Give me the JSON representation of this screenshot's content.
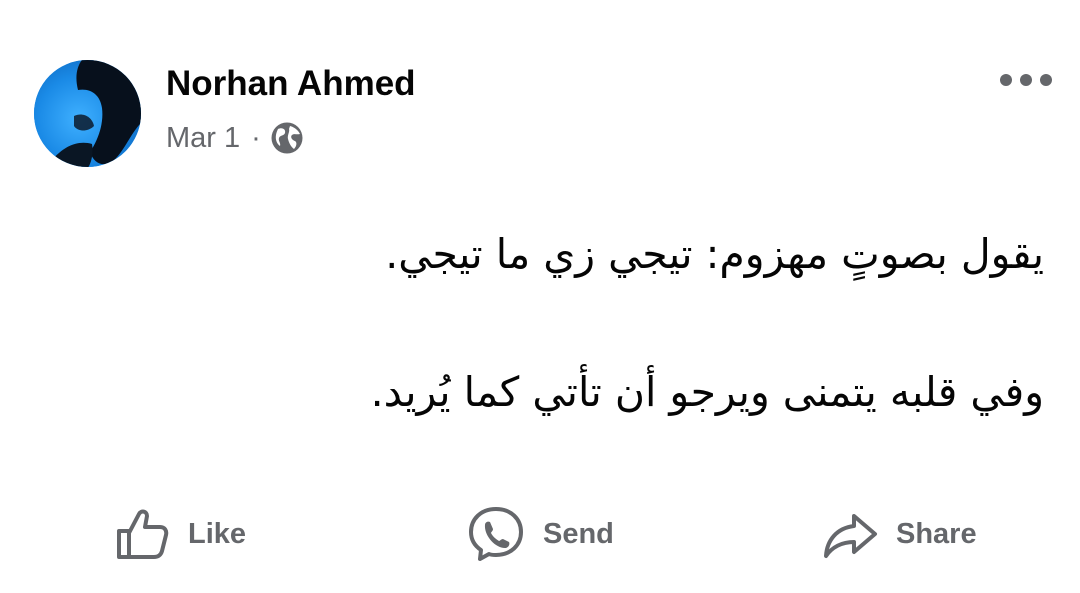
{
  "post": {
    "author": "Norhan Ahmed",
    "date": "Mar 1",
    "separator": "·",
    "privacy_icon": "globe-icon",
    "menu_icon": "more-options-icon",
    "text_lines": [
      "يقول بصوتٍ مهزوم: تيجي زي ما تيجي.",
      "وفي قلبه يتمنى ويرجو أن تأتي كما يُريد."
    ]
  },
  "actions": [
    {
      "label": "Like",
      "icon": "thumbs-up-icon"
    },
    {
      "label": "Send",
      "icon": "messenger-icon"
    },
    {
      "label": "Share",
      "icon": "share-arrow-icon"
    }
  ],
  "colors": {
    "text_primary": "#050505",
    "text_secondary": "#65676b",
    "avatar_blue": "#1d8fe8"
  }
}
